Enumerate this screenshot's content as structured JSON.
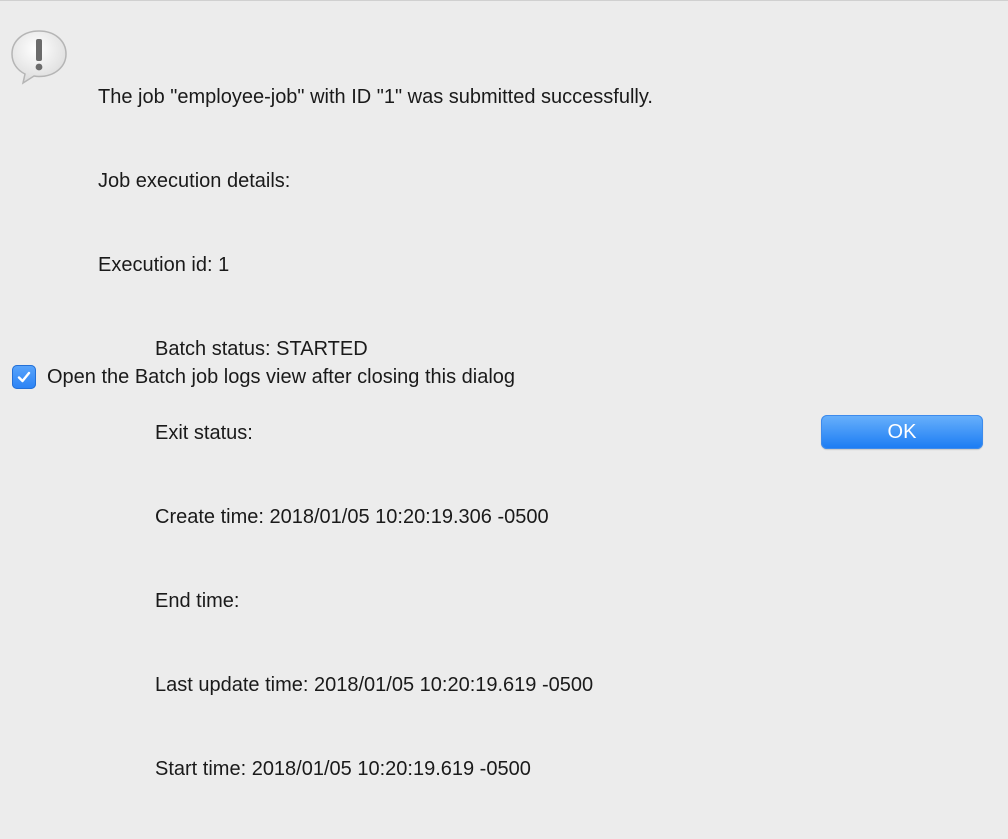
{
  "dialog": {
    "icon": "exclamation-speech-bubble-icon",
    "message_lines": [
      "The job \"employee-job\" with ID \"1\" was submitted successfully.",
      "Job execution details:",
      "Execution id: 1"
    ],
    "details": [
      "Batch status: STARTED",
      "Exit status:",
      "Create time: 2018/01/05 10:20:19.306 -0500",
      "End time:",
      "Last update time: 2018/01/05 10:20:19.619 -0500",
      "Start time: 2018/01/05 10:20:19.619 -0500"
    ],
    "checkbox": {
      "checked": true,
      "label": "Open the Batch job logs view after closing this dialog"
    },
    "ok_label": "OK"
  },
  "colors": {
    "background": "#ececec",
    "accent": "#1a7bf3",
    "button_text": "#ffffff"
  }
}
